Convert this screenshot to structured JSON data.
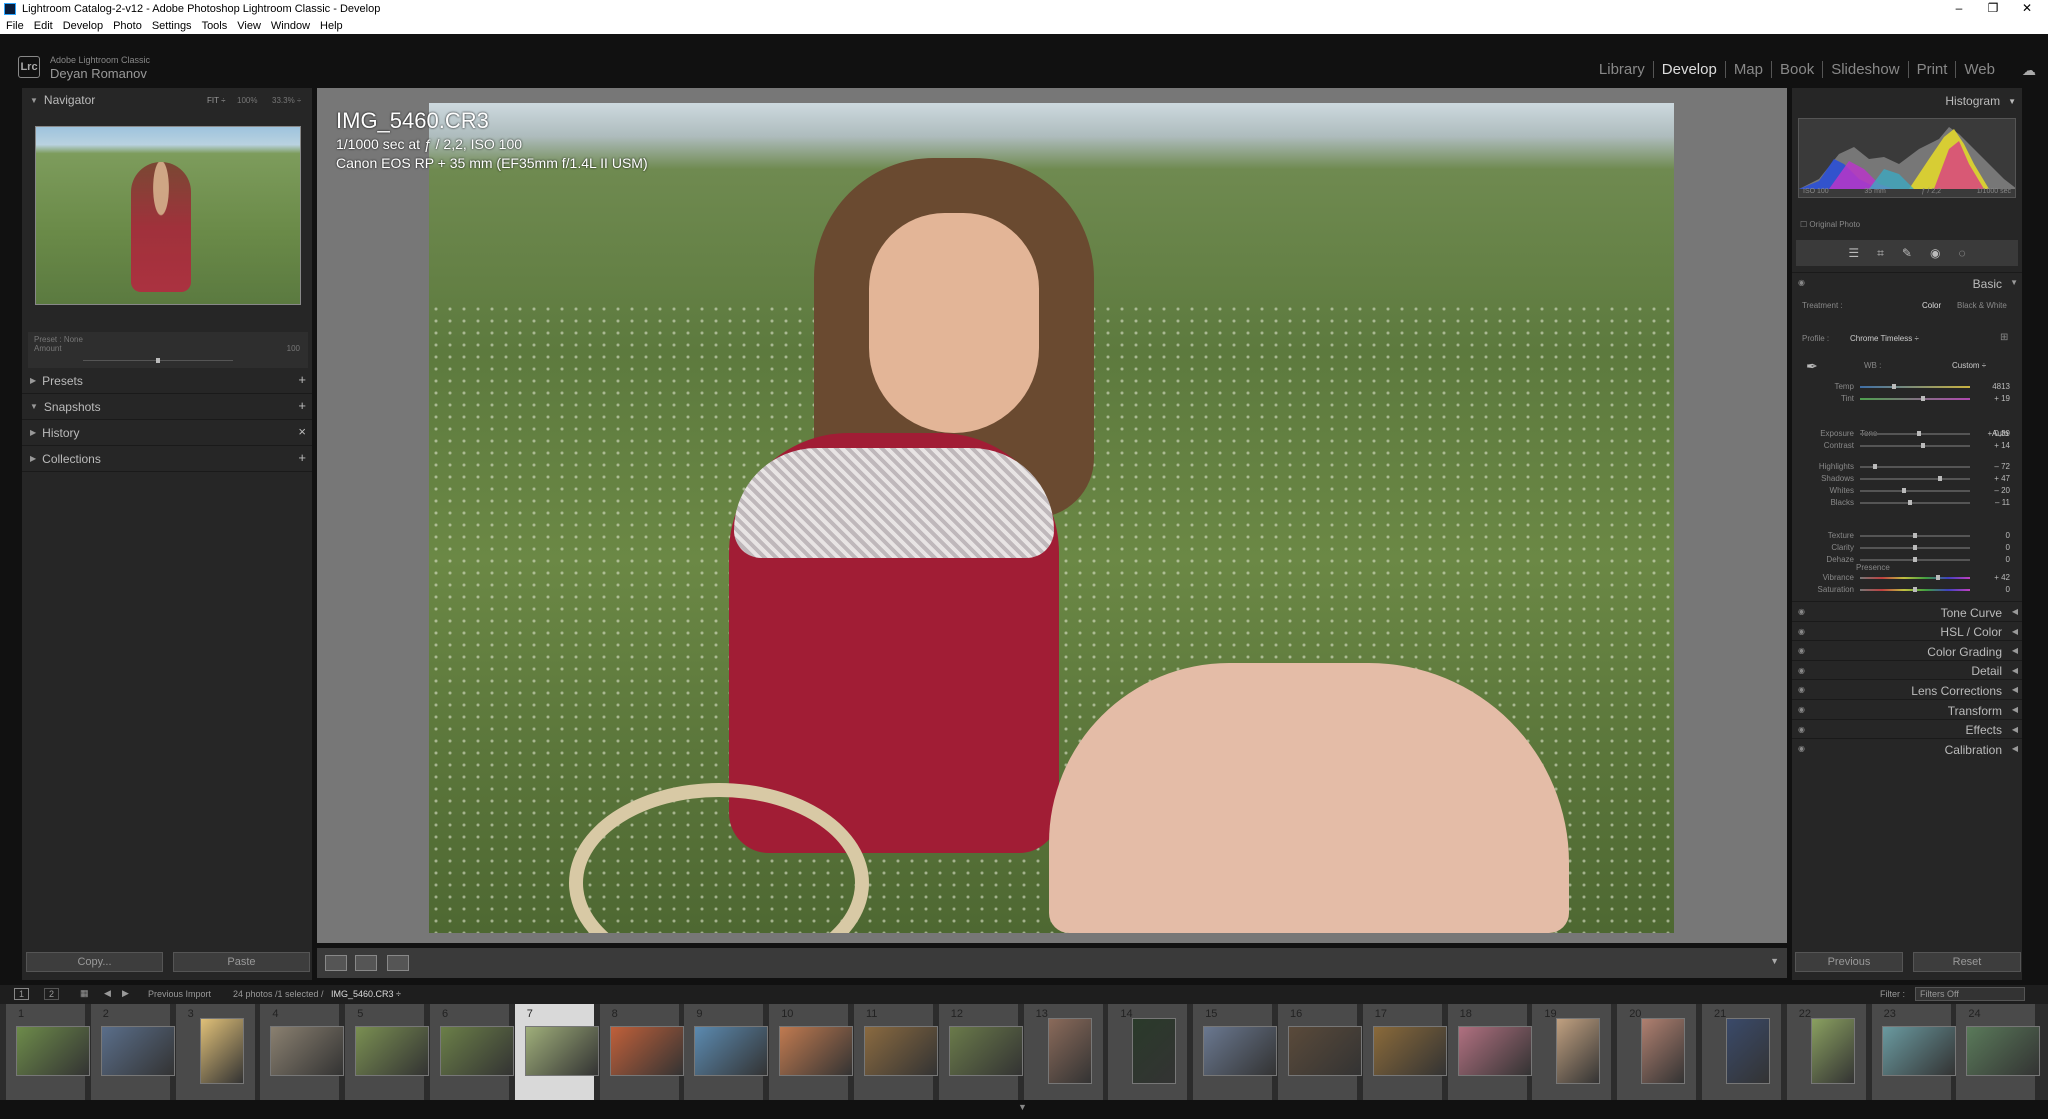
{
  "window": {
    "title": "Lightroom Catalog-2-v12 - Adobe Photoshop Lightroom Classic - Develop",
    "minimize": "–",
    "maximize": "❐",
    "close": "✕"
  },
  "menu": [
    "File",
    "Edit",
    "Develop",
    "Photo",
    "Settings",
    "Tools",
    "View",
    "Window",
    "Help"
  ],
  "identity": {
    "app": "Adobe Lightroom Classic",
    "user": "Deyan Romanov",
    "logo": "Lrc"
  },
  "modules": [
    "Library",
    "Develop",
    "Map",
    "Book",
    "Slideshow",
    "Print",
    "Web"
  ],
  "active_module": "Develop",
  "navigator": {
    "title": "Navigator",
    "zoom": [
      "FIT ÷",
      "100%",
      "33.3% ÷"
    ]
  },
  "preset": {
    "label": "Preset :",
    "value": "None",
    "amount": "Amount",
    "amount_val": "100"
  },
  "left_sections": [
    {
      "label": "Presets",
      "action": "+"
    },
    {
      "label": "Snapshots",
      "action": "+"
    },
    {
      "label": "History",
      "action": "×"
    },
    {
      "label": "Collections",
      "action": "+"
    }
  ],
  "left_buttons": {
    "copy": "Copy...",
    "paste": "Paste"
  },
  "exif": {
    "filename": "IMG_5460.CR3",
    "exposure": "1/1000 sec at ƒ / 2,2, ISO 100",
    "camera": "Canon EOS RP + 35 mm (EF35mm f/1.4L II USM)"
  },
  "histogram": {
    "title": "Histogram",
    "iso": "ISO 100",
    "focal": "35 mm",
    "aperture": "ƒ / 2,2",
    "shutter": "1/1000 sec",
    "original": "Original Photo"
  },
  "basic": {
    "title": "Basic",
    "treatment_label": "Treatment :",
    "color": "Color",
    "bw": "Black & White",
    "profile_label": "Profile :",
    "profile": "Chrome Timeless ÷",
    "wb_label": "WB :",
    "wb": "Custom ÷",
    "tone_label": "Tone",
    "auto": "Auto",
    "presence_label": "Presence",
    "sliders": [
      {
        "name": "Temp",
        "value": "4813",
        "pos": 0.31
      },
      {
        "name": "Tint",
        "value": "+ 19",
        "pos": 0.57
      },
      {
        "name": "Exposure",
        "value": "+ 0,39",
        "pos": 0.54
      },
      {
        "name": "Contrast",
        "value": "+ 14",
        "pos": 0.57
      },
      {
        "name": "Highlights",
        "value": "– 72",
        "pos": 0.14
      },
      {
        "name": "Shadows",
        "value": "+ 47",
        "pos": 0.73
      },
      {
        "name": "Whites",
        "value": "– 20",
        "pos": 0.4
      },
      {
        "name": "Blacks",
        "value": "– 11",
        "pos": 0.45
      },
      {
        "name": "Texture",
        "value": "0",
        "pos": 0.5
      },
      {
        "name": "Clarity",
        "value": "0",
        "pos": 0.5
      },
      {
        "name": "Dehaze",
        "value": "0",
        "pos": 0.5
      },
      {
        "name": "Vibrance",
        "value": "+ 42",
        "pos": 0.71
      },
      {
        "name": "Saturation",
        "value": "0",
        "pos": 0.5
      }
    ]
  },
  "right_sections": [
    "Tone Curve",
    "HSL / Color",
    "Color Grading",
    "Detail",
    "Lens Corrections",
    "Transform",
    "Effects",
    "Calibration"
  ],
  "right_buttons": {
    "previous": "Previous",
    "reset": "Reset"
  },
  "filmstrip": {
    "page1": "1",
    "page2": "2",
    "source": "Previous Import",
    "count": "24 photos /1 selected /",
    "current": "IMG_5460.CR3 ÷",
    "filter_label": "Filter :",
    "filter": "Filters Off",
    "numbers": [
      "1",
      "2",
      "3",
      "4",
      "5",
      "6",
      "7",
      "8",
      "9",
      "10",
      "11",
      "12",
      "13",
      "14",
      "15",
      "16",
      "17",
      "18",
      "19",
      "20",
      "21",
      "22",
      "23",
      "24"
    ],
    "selected": 7
  }
}
